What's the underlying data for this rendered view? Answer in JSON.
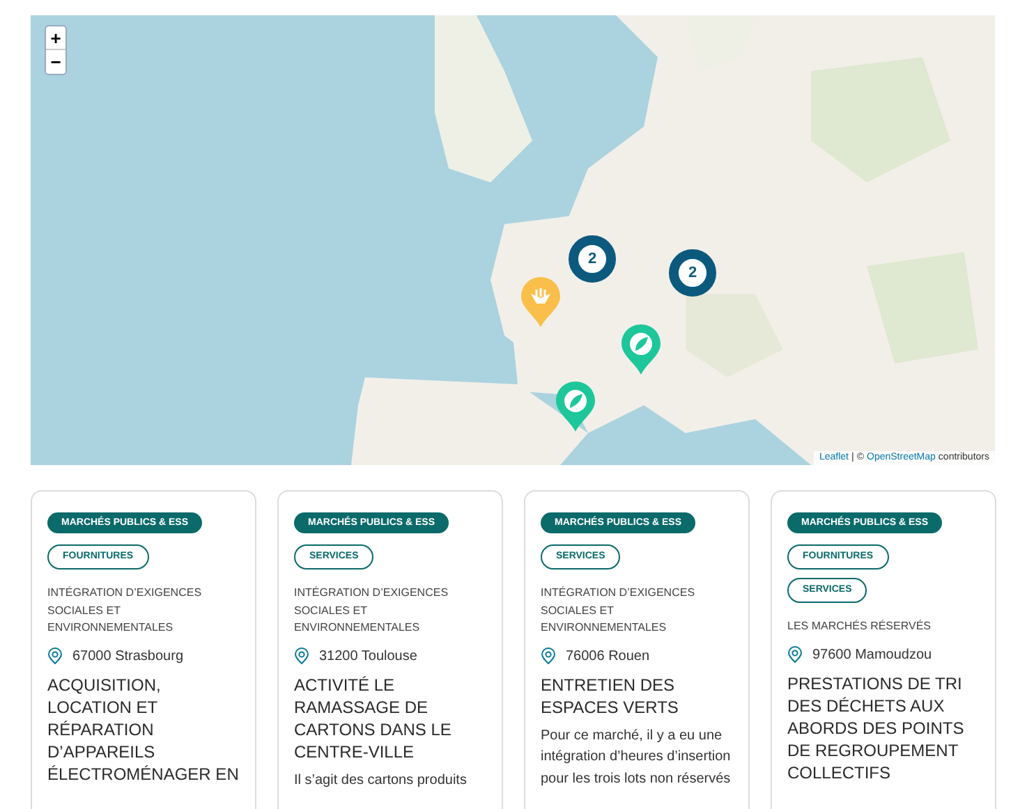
{
  "map": {
    "zoom_controls": [
      "+",
      "−"
    ],
    "markers": [
      {
        "kind": "cluster",
        "count": "2"
      },
      {
        "kind": "cluster",
        "count": "2"
      },
      {
        "kind": "hands",
        "color": "#f9bf4a"
      },
      {
        "kind": "leaf",
        "color": "#1dc79a"
      },
      {
        "kind": "leaf",
        "color": "#1dc79a"
      }
    ],
    "attribution": {
      "library": "Leaflet",
      "separator": "|",
      "copyright": "©",
      "source": "OpenStreetMap",
      "suffix": "contributors"
    }
  },
  "cards": [
    {
      "badge": "MARCHÉS PUBLICS & ESS",
      "tags": [
        "FOURNITURES"
      ],
      "category": "INTÉGRATION D’EXIGENCES SOCIALES ET ENVIRONNEMENTALES",
      "location": "67000 Strasbourg",
      "title": "ACQUISITION, LOCATION ET RÉPARATION D’APPAREILS ÉLECTROMÉNAGER EN"
    },
    {
      "badge": "MARCHÉS PUBLICS & ESS",
      "tags": [
        "SERVICES"
      ],
      "category": "INTÉGRATION D’EXIGENCES SOCIALES ET ENVIRONNEMENTALES",
      "location": "31200 Toulouse",
      "title": "ACTIVITÉ LE RAMASSAGE DE CARTONS DANS LE CENTRE-VILLE",
      "description": "Il s’agit des cartons produits"
    },
    {
      "badge": "MARCHÉS PUBLICS & ESS",
      "tags": [
        "SERVICES"
      ],
      "category": "INTÉGRATION D’EXIGENCES SOCIALES ET ENVIRONNEMENTALES",
      "location": "76006 Rouen",
      "title": "ENTRETIEN DES ESPACES VERTS",
      "description": "Pour ce marché, il y a eu une intégration d’heures d’insertion pour les trois lots non réservés"
    },
    {
      "badge": "MARCHÉS PUBLICS & ESS",
      "tags": [
        "FOURNITURES",
        "SERVICES"
      ],
      "category": "LES MARCHÉS RÉSERVÉS",
      "location": "97600 Mamoudzou",
      "title": "PRESTATIONS DE TRI DES DÉCHETS AUX ABORDS DES POINTS DE REGROUPEMENT COLLECTIFS"
    }
  ]
}
